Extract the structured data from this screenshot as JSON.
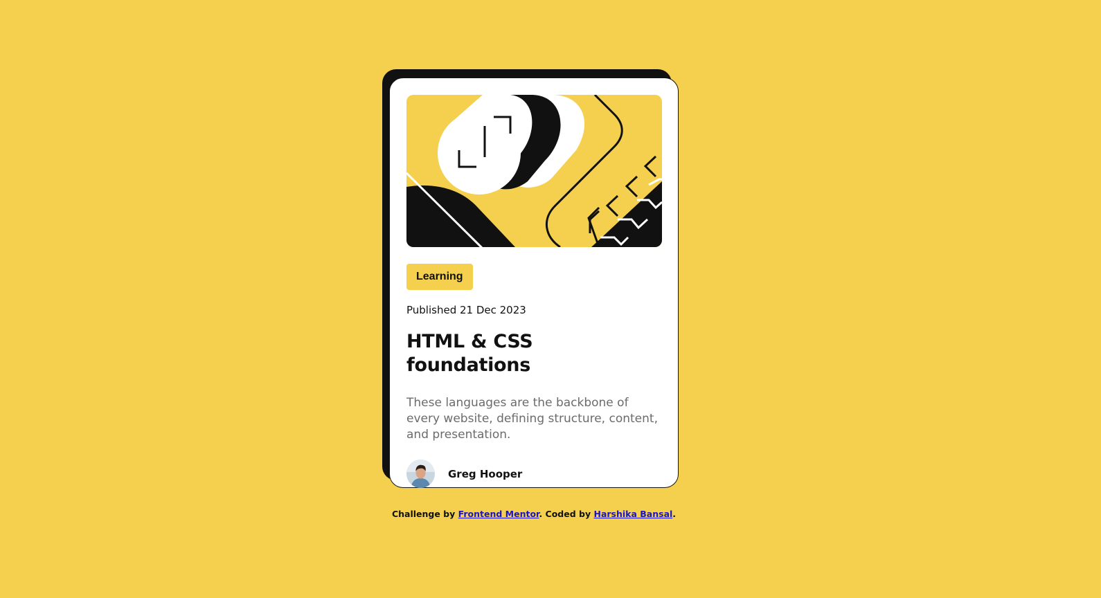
{
  "card": {
    "tag": "Learning",
    "published": "Published 21 Dec 2023",
    "title": "HTML & CSS foundations",
    "description": "These languages are the backbone of every website, defining structure, content, and presentation.",
    "author": "Greg Hooper"
  },
  "footer": {
    "prefix": "Challenge by ",
    "link1": "Frontend Mentor",
    "middle": ". Coded by ",
    "link2": "Harshika Bansal",
    "suffix": "."
  },
  "colors": {
    "background": "#F4D04E",
    "card": "#FFFFFF",
    "ink": "#111111",
    "muted": "#6B6B6B",
    "link": "#1A13C9"
  },
  "icons": {
    "hero": "abstract-illustration",
    "avatar": "author-portrait"
  }
}
